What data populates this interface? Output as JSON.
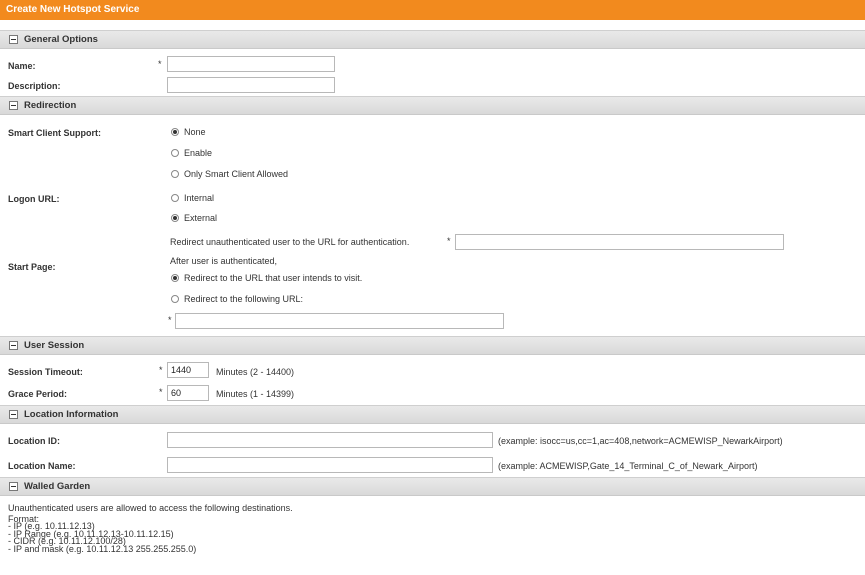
{
  "title": "Create New Hotspot Service",
  "sections": {
    "general": "General Options",
    "redirection": "Redirection",
    "user_session": "User Session",
    "location": "Location Information",
    "walled_garden": "Walled Garden"
  },
  "required_mark": "*",
  "general": {
    "name_label": "Name:",
    "name_value": "",
    "description_label": "Description:",
    "description_value": ""
  },
  "redirection": {
    "smart_client_label": "Smart Client Support:",
    "smart_client_options": [
      "None",
      "Enable",
      "Only Smart Client Allowed"
    ],
    "smart_client_selected": "None",
    "logon_url_label": "Logon URL:",
    "logon_url_options": [
      "Internal",
      "External"
    ],
    "logon_url_selected": "External",
    "redirect_text": "Redirect unauthenticated user to the URL for authentication.",
    "redirect_value": "",
    "start_page_label": "Start Page:",
    "start_page_intro": "After user is authenticated,",
    "start_page_options": [
      "Redirect to the URL that user intends to visit.",
      "Redirect to the following URL:"
    ],
    "start_page_selected": "Redirect to the URL that user intends to visit.",
    "start_page_url_value": ""
  },
  "user_session": {
    "timeout_label": "Session Timeout:",
    "timeout_value": "1440",
    "timeout_hint": "Minutes (2 - 14400)",
    "grace_label": "Grace Period:",
    "grace_value": "60",
    "grace_hint": "Minutes (1 - 14399)"
  },
  "location": {
    "id_label": "Location ID:",
    "id_value": "",
    "id_example": "(example: isocc=us,cc=1,ac=408,network=ACMEWISP_NewarkAirport)",
    "name_label": "Location Name:",
    "name_value": "",
    "name_example": "(example: ACMEWISP,Gate_14_Terminal_C_of_Newark_Airport)"
  },
  "walled_garden": {
    "help_lines": [
      "Unauthenticated users are allowed to access the following destinations.",
      "Format:",
      "- IP (e.g. 10.11.12.13)",
      "- IP Range (e.g. 10.11.12.13-10.11.12.15)",
      "- CIDR (e.g. 10.11.12.100/28)",
      "- IP and mask (e.g. 10.11.12.13 255.255.255.0)"
    ]
  }
}
